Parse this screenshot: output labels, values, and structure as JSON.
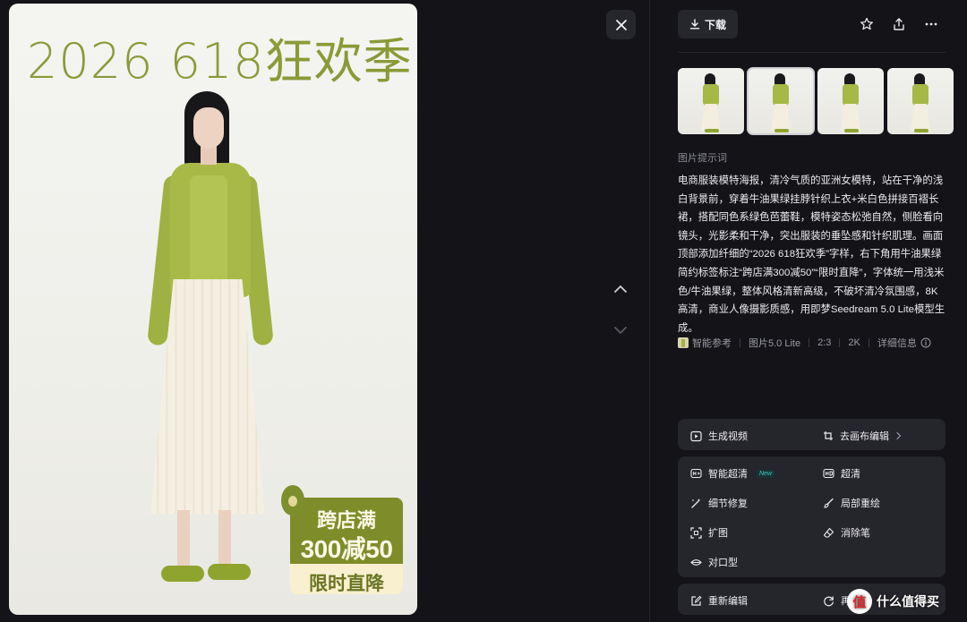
{
  "poster": {
    "title": "2026 618狂欢季",
    "promo_line1": "跨店满",
    "promo_line2": "300减50",
    "promo_line3": "限时直降"
  },
  "toolbar": {
    "download_label": "下载",
    "icons": [
      "download-icon",
      "star-icon",
      "share-icon",
      "more-icon",
      "close-icon"
    ]
  },
  "navigation": {
    "icons": [
      "chevron-up-icon",
      "chevron-down-icon"
    ]
  },
  "thumbnails": {
    "count": 4,
    "active_index": 1
  },
  "prompt": {
    "label": "图片提示词",
    "text": "电商服装模特海报，清冷气质的亚洲女模特，站在干净的浅白背景前，穿着牛油果绿挂脖针织上衣+米白色拼接百褶长裙，搭配同色系绿色芭蕾鞋，模特姿态松弛自然，侧脸看向镜头，光影柔和干净，突出服装的垂坠感和针织肌理。画面顶部添加纤细的“2026 618狂欢季”字样，右下角用牛油果绿简约标签标注“跨店满300减50”“限时直降”，字体统一用浅米色/牛油果绿，整体风格清新高级，不破坏清冷氛围感，8K高清，商业人像摄影质感，用即梦Seedream 5.0 Lite模型生成。"
  },
  "meta": {
    "reference": "智能参考",
    "model": "图片5.0 Lite",
    "ratio": "2:3",
    "resolution": "2K",
    "details": "详细信息"
  },
  "actions": {
    "generate_video": "生成视频",
    "canvas_edit": "去画布编辑",
    "smart_upscale": "智能超清",
    "new_badge": "New",
    "upscale": "超清",
    "detail_repair": "细节修复",
    "partial_redraw": "局部重绘",
    "expand": "扩图",
    "eraser": "消除笔",
    "lip_sync": "对口型",
    "re_edit": "重新编辑",
    "regenerate": "再"
  },
  "watermark": {
    "logo": "值",
    "text": "什么值得买"
  },
  "colors": {
    "background": "#131318",
    "card": "#25252c",
    "poster_green": "#8a9a37",
    "badge_cyan": "#39c6c0"
  }
}
